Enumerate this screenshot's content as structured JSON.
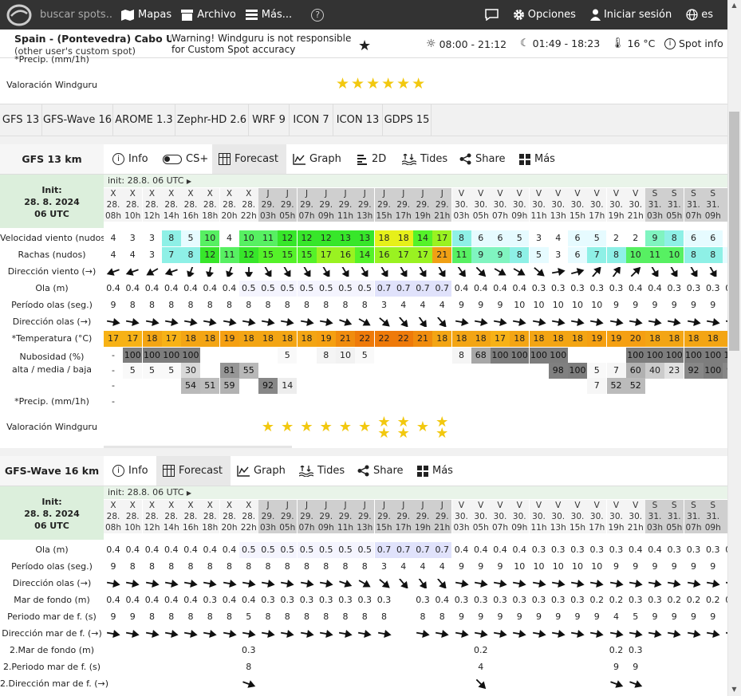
{
  "header": {
    "search_placeholder": "buscar spots...",
    "maps": "Mapas",
    "archive": "Archivo",
    "more": "Más...",
    "help": "?",
    "options": "Opciones",
    "login": "Iniciar sesión",
    "lang": "es"
  },
  "spot": {
    "name": "Spain - (Pontevedra) Cabo Udra",
    "sub": "(other user's custom spot)",
    "warning": "Warning! Windguru is not responsible\nfor Custom Spot accuracy",
    "sun": "08:00 - 21:12",
    "moon": "01:49 - 18:23",
    "temp": "16 °C",
    "info": "Spot info"
  },
  "top_partial": {
    "precip_label": "*Precip. (mm/1h)",
    "rating_label": "Valoración Windguru",
    "stars": "★★★★★★"
  },
  "models": [
    "GFS 13",
    "GFS-Wave 16",
    "AROME 1.3",
    "Zephr-HD 2.6",
    "WRF 9",
    "ICON 7",
    "ICON 13",
    "GDPS 15"
  ],
  "gfs": {
    "name": "GFS 13 km",
    "tabs": [
      "Info",
      "CS+",
      "Forecast",
      "Graph",
      "2D",
      "Tides",
      "Share",
      "Más"
    ],
    "init_label": "Init:",
    "init_date": "28. 8. 2024",
    "init_time": "06 UTC",
    "init_line": "init: 28.8. 06 UTC",
    "labels": {
      "wind": "Velocidad viento (nudos)",
      "gust": "Rachas (nudos)",
      "dir": "Dirección viento (→)",
      "wave": "Ola (m)",
      "period": "Período olas (seg.)",
      "wdir": "Dirección olas (→)",
      "temp": "*Temperatura (°C)",
      "cloud": "Nubosidad (%)",
      "cloud2": "alta / media / baja",
      "precip": "*Precip. (mm/1h)",
      "rating": "Valoración Windguru"
    },
    "days": [
      "X",
      "X",
      "X",
      "X",
      "X",
      "X",
      "X",
      "X",
      "J",
      "J",
      "J",
      "J",
      "J",
      "J",
      "J",
      "J",
      "J",
      "J",
      "V",
      "V",
      "V",
      "V",
      "V",
      "V",
      "V",
      "V",
      "V",
      "V",
      "S",
      "S",
      "S",
      "S",
      "S"
    ],
    "dates": [
      "28.",
      "28.",
      "28.",
      "28.",
      "28.",
      "28.",
      "28.",
      "28.",
      "29.",
      "29.",
      "29.",
      "29.",
      "29.",
      "29.",
      "29.",
      "29.",
      "29.",
      "29.",
      "30.",
      "30.",
      "30.",
      "30.",
      "30.",
      "30.",
      "30.",
      "30.",
      "30.",
      "30.",
      "31.",
      "31.",
      "31.",
      "31.",
      "31"
    ],
    "hours": [
      "08h",
      "10h",
      "12h",
      "14h",
      "16h",
      "18h",
      "20h",
      "22h",
      "03h",
      "05h",
      "07h",
      "09h",
      "11h",
      "13h",
      "15h",
      "17h",
      "19h",
      "21h",
      "03h",
      "05h",
      "07h",
      "09h",
      "11h",
      "13h",
      "15h",
      "17h",
      "19h",
      "21h",
      "03h",
      "05h",
      "07h",
      "09h",
      "1"
    ],
    "wind": [
      "4",
      "3",
      "3",
      "8",
      "5",
      "10",
      "4",
      "10",
      "11",
      "12",
      "12",
      "12",
      "13",
      "13",
      "18",
      "18",
      "14",
      "17",
      "8",
      "6",
      "6",
      "5",
      "3",
      "4",
      "6",
      "5",
      "2",
      "2",
      "9",
      "8",
      "6",
      "6",
      "4"
    ],
    "gust": [
      "4",
      "4",
      "3",
      "7",
      "8",
      "12",
      "11",
      "12",
      "15",
      "15",
      "15",
      "17",
      "16",
      "14",
      "16",
      "17",
      "17",
      "21",
      "11",
      "9",
      "9",
      "8",
      "5",
      "3",
      "6",
      "7",
      "8",
      "10",
      "11",
      "10",
      "8",
      "8",
      "5"
    ],
    "wind_dir": [
      250,
      250,
      240,
      250,
      200,
      190,
      200,
      180,
      150,
      150,
      150,
      150,
      150,
      150,
      150,
      150,
      150,
      150,
      145,
      135,
      120,
      120,
      130,
      80,
      75,
      40,
      35,
      45,
      150,
      150,
      150,
      150,
      150
    ],
    "wave": [
      "0.4",
      "0.4",
      "0.4",
      "0.4",
      "0.4",
      "0.4",
      "0.4",
      "0.5",
      "0.5",
      "0.5",
      "0.5",
      "0.5",
      "0.5",
      "0.5",
      "0.7",
      "0.7",
      "0.7",
      "0.7",
      "0.4",
      "0.4",
      "0.4",
      "0.4",
      "0.3",
      "0.3",
      "0.3",
      "0.3",
      "0.3",
      "0.4",
      "0.4",
      "0.3",
      "0.3",
      "0.3",
      "0.3"
    ],
    "period": [
      "9",
      "8",
      "8",
      "8",
      "8",
      "8",
      "8",
      "8",
      "8",
      "8",
      "8",
      "8",
      "8",
      "8",
      "3",
      "4",
      "4",
      "4",
      "9",
      "9",
      "9",
      "10",
      "10",
      "10",
      "10",
      "10",
      "9",
      "9",
      "9",
      "9",
      "9",
      "9",
      "9"
    ],
    "wave_dir": [
      100,
      100,
      100,
      100,
      100,
      100,
      100,
      100,
      100,
      100,
      100,
      100,
      110,
      120,
      130,
      140,
      145,
      140,
      100,
      100,
      100,
      100,
      100,
      100,
      100,
      100,
      100,
      100,
      100,
      100,
      100,
      100,
      100
    ],
    "temp": [
      "17",
      "17",
      "18",
      "17",
      "18",
      "18",
      "19",
      "18",
      "18",
      "18",
      "18",
      "19",
      "21",
      "22",
      "22",
      "22",
      "21",
      "18",
      "18",
      "18",
      "17",
      "18",
      "18",
      "18",
      "18",
      "19",
      "19",
      "20",
      "18",
      "18",
      "18",
      "18",
      "18"
    ],
    "cloud_high": [
      "-",
      "100",
      "100",
      "100",
      "100",
      "",
      "",
      "",
      "",
      "5",
      "",
      "8",
      "10",
      "5",
      "",
      "",
      "",
      "",
      "8",
      "68",
      "100",
      "100",
      "100",
      "100",
      "",
      "",
      "",
      "100",
      "100",
      "100",
      "100",
      "100",
      "100"
    ],
    "cloud_mid": [
      "-",
      "5",
      "5",
      "5",
      "30",
      "",
      "81",
      "55",
      "",
      "",
      "",
      "",
      "",
      "",
      "",
      "",
      "",
      "",
      "",
      "",
      "",
      "",
      "",
      "98",
      "100",
      "5",
      "7",
      "60",
      "40",
      "23",
      "92",
      "100",
      "92"
    ],
    "cloud_low": [
      "-",
      "",
      "",
      "",
      "54",
      "51",
      "59",
      "",
      "92",
      "14",
      "",
      "",
      "",
      "",
      "",
      "",
      "",
      "",
      "",
      "",
      "",
      "",
      "",
      "",
      "",
      "7",
      "52",
      "52",
      "",
      "",
      "",
      "",
      ""
    ],
    "precip": [
      "-",
      "",
      "",
      "",
      "",
      "",
      "",
      "",
      "",
      "",
      "",
      "",
      "",
      "",
      "",
      "",
      "",
      "",
      "",
      "",
      "",
      "",
      "",
      "",
      "",
      "",
      "",
      "",
      "",
      "",
      "",
      "",
      ""
    ],
    "rating": [
      "",
      "",
      "",
      "",
      "",
      "",
      "",
      "",
      "1",
      "1",
      "1",
      "1",
      "1",
      "1",
      "2",
      "2",
      "1",
      "2",
      "",
      "",
      "",
      "",
      "",
      "",
      "",
      "",
      "",
      "",
      "",
      "",
      "",
      "",
      ""
    ]
  },
  "wave": {
    "name": "GFS-Wave 16 km",
    "tabs": [
      "Info",
      "Forecast",
      "Graph",
      "Tides",
      "Share",
      "Más"
    ],
    "init_label": "Init:",
    "init_date": "28. 8. 2024",
    "init_time": "06 UTC",
    "init_line": "init: 28.8. 06 UTC",
    "labels": {
      "wave": "Ola (m)",
      "period": "Período olas (seg.)",
      "wdir": "Dirección olas (→)",
      "swell": "Mar de fondo (m)",
      "swell_period": "Periodo mar de f. (s)",
      "swell_dir": "Dirección mar de f. (→)",
      "swell2": "2.Mar de fondo (m)",
      "swell2_period": "2.Periodo mar de f. (s)",
      "swell2_dir": "2.Dirección mar de f. (→)"
    },
    "wave": [
      "0.4",
      "0.4",
      "0.4",
      "0.4",
      "0.4",
      "0.4",
      "0.4",
      "0.5",
      "0.5",
      "0.5",
      "0.5",
      "0.5",
      "0.5",
      "0.5",
      "0.7",
      "0.7",
      "0.7",
      "0.7",
      "0.4",
      "0.4",
      "0.4",
      "0.4",
      "0.3",
      "0.3",
      "0.3",
      "0.3",
      "0.3",
      "0.4",
      "0.4",
      "0.3",
      "0.3",
      "0.3",
      "0.3"
    ],
    "period": [
      "9",
      "8",
      "8",
      "8",
      "8",
      "8",
      "8",
      "8",
      "8",
      "8",
      "8",
      "8",
      "8",
      "8",
      "3",
      "4",
      "4",
      "4",
      "9",
      "9",
      "9",
      "10",
      "10",
      "10",
      "10",
      "10",
      "9",
      "9",
      "9",
      "9",
      "9",
      "9",
      "9"
    ],
    "wave_dir": [
      100,
      100,
      100,
      100,
      100,
      100,
      100,
      100,
      100,
      100,
      100,
      100,
      110,
      120,
      130,
      140,
      145,
      140,
      100,
      100,
      100,
      100,
      100,
      100,
      100,
      100,
      100,
      100,
      100,
      100,
      100,
      100,
      100
    ],
    "swell": [
      "0.4",
      "0.4",
      "0.4",
      "0.4",
      "0.4",
      "0.3",
      "0.4",
      "0.4",
      "0.3",
      "0.3",
      "0.3",
      "0.3",
      "0.3",
      "0.3",
      "0.3",
      "",
      "0.3",
      "0.4",
      "0.3",
      "0.3",
      "0.3",
      "0.3",
      "0.3",
      "0.3",
      "0.3",
      "0.2",
      "0.2",
      "0.3",
      "0.3",
      "0.2",
      "0.2",
      "0.2",
      "0.3"
    ],
    "swell_period": [
      "9",
      "9",
      "8",
      "8",
      "8",
      "8",
      "8",
      "5",
      "8",
      "8",
      "8",
      "8",
      "8",
      "8",
      "8",
      "",
      "8",
      "8",
      "9",
      "9",
      "9",
      "9",
      "9",
      "9",
      "9",
      "9",
      "4",
      "5",
      "9",
      "9",
      "9",
      "9",
      "9"
    ],
    "swell_dir": [
      100,
      100,
      100,
      100,
      100,
      100,
      100,
      100,
      100,
      100,
      100,
      100,
      100,
      100,
      100,
      null,
      100,
      100,
      100,
      100,
      100,
      100,
      100,
      100,
      100,
      100,
      100,
      100,
      100,
      100,
      100,
      100,
      100
    ],
    "swell2": [
      "",
      "",
      "",
      "",
      "",
      "",
      "",
      "0.3",
      "",
      "",
      "",
      "",
      "",
      "",
      "",
      "",
      "",
      "",
      "",
      "0.2",
      "",
      "",
      "",
      "",
      "",
      "",
      "0.2",
      "0.3",
      "",
      "",
      "",
      "",
      ""
    ],
    "swell2_period": [
      "",
      "",
      "",
      "",
      "",
      "",
      "",
      "8",
      "",
      "",
      "",
      "",
      "",
      "",
      "",
      "",
      "",
      "",
      "",
      "4",
      "",
      "",
      "",
      "",
      "",
      "",
      "9",
      "9",
      "",
      "",
      "",
      "",
      ""
    ],
    "swell2_dir": [
      null,
      null,
      null,
      null,
      null,
      null,
      null,
      110,
      null,
      null,
      null,
      null,
      null,
      null,
      null,
      null,
      null,
      null,
      null,
      135,
      null,
      null,
      null,
      null,
      null,
      null,
      110,
      110,
      null,
      null,
      null,
      null,
      null
    ]
  },
  "colors": {
    "topbar": "#333333",
    "star": "#f2c80f"
  }
}
